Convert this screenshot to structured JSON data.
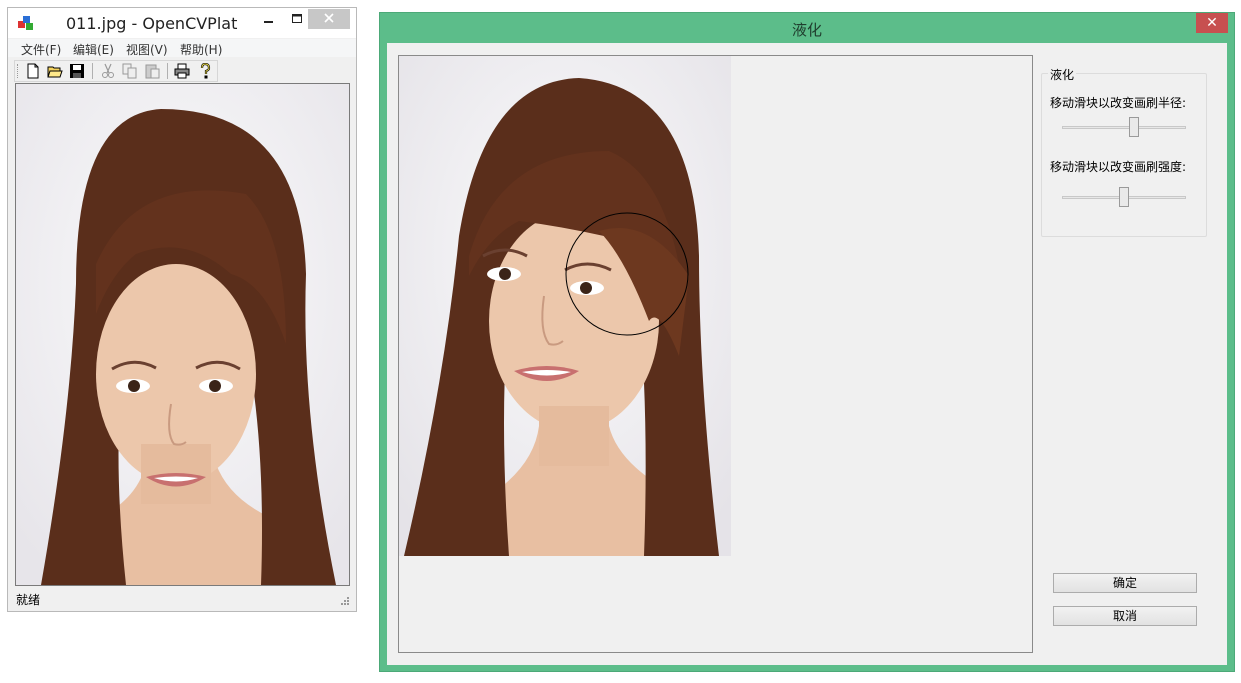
{
  "main_window": {
    "title": "011.jpg - OpenCVPlat",
    "controls": {
      "minimize": "–",
      "maximize": "□"
    },
    "menu": [
      "文件(F)",
      "编辑(E)",
      "视图(V)",
      "帮助(H)"
    ],
    "toolbar": [
      "new-icon",
      "open-icon",
      "save-icon",
      "cut-icon",
      "copy-icon",
      "paste-icon",
      "print-icon",
      "help-icon"
    ],
    "status": "就绪"
  },
  "dialog": {
    "title": "液化",
    "close": "✕",
    "group_label": "液化",
    "brush_radius_label": "移动滑块以改变画刷半径:",
    "brush_radius_value": 0.58,
    "brush_strength_label": "移动滑块以改变画刷强度:",
    "brush_strength_value": 0.5,
    "ok_label": "确定",
    "cancel_label": "取消"
  },
  "colors": {
    "dialog_frame": "#5cbd8a",
    "close_red": "#c75050",
    "hair": "#5a2e1b",
    "skin": "#e9c2a5"
  }
}
